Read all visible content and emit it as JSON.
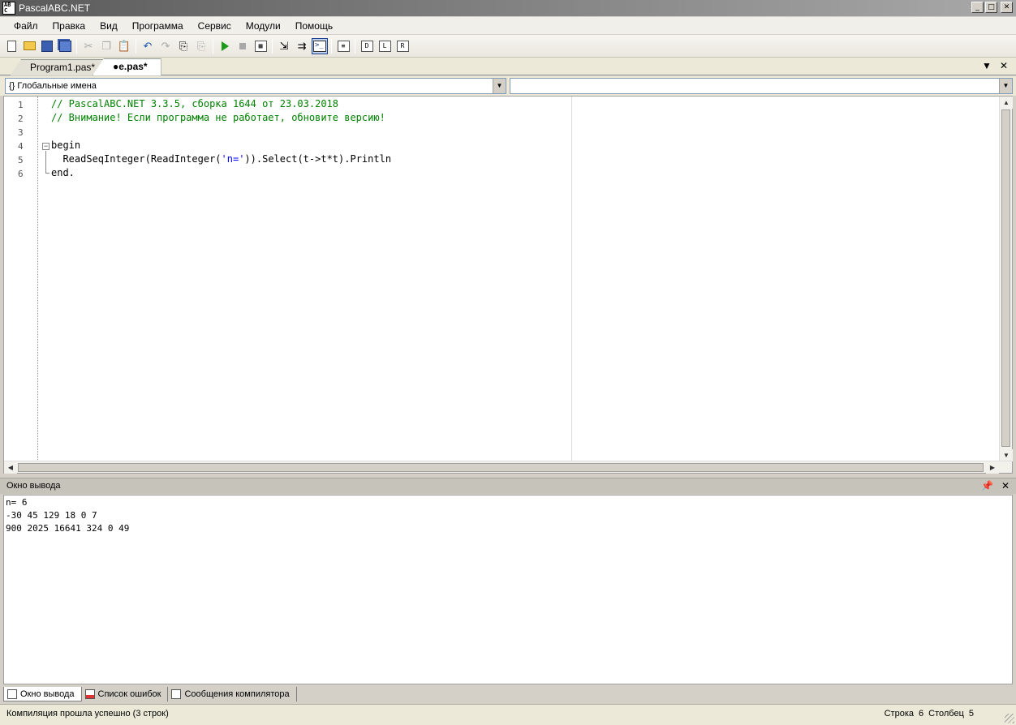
{
  "window": {
    "title": "PascalABC.NET",
    "icon_text": "AB\nC"
  },
  "menu": [
    "Файл",
    "Правка",
    "Вид",
    "Программа",
    "Сервис",
    "Модули",
    "Помощь"
  ],
  "tabs": [
    {
      "label": "Program1.pas*"
    },
    {
      "label": "●e.pas*"
    }
  ],
  "combos": {
    "left": "Глобальные имена",
    "left_prefix": "{}",
    "right": ""
  },
  "code": {
    "line_numbers": [
      "1",
      "2",
      "3",
      "4",
      "5",
      "6"
    ],
    "line1": "// PascalABC.NET 3.3.5, сборка 1644 от 23.03.2018",
    "line2": "// Внимание! Если программа не работает, обновите версию!",
    "line4": "begin",
    "line5_a": "  ReadSeqInteger(ReadInteger(",
    "line5_str": "'n='",
    "line5_b": ")).Select(t->t*t).Println",
    "line6": "end."
  },
  "output_panel": {
    "title": "Окно вывода",
    "lines": [
      "n= 6",
      "-30 45 129 18 0 7",
      "900 2025 16641 324 0 49"
    ]
  },
  "bottom_tabs": [
    "Окно вывода",
    "Список ошибок",
    "Сообщения компилятора"
  ],
  "status": {
    "message": "Компиляция прошла успешно (3 строк)",
    "row_label": "Строка",
    "row_value": "6",
    "col_label": "Столбец",
    "col_value": "5"
  },
  "colors": {
    "comment": "#008000",
    "string": "#0000ff",
    "accent": "#1c3d8a"
  },
  "toolbar_icons": [
    "new-file-icon",
    "open-folder-icon",
    "save-icon",
    "save-all-icon",
    "cut-icon",
    "copy-icon",
    "paste-icon",
    "undo-icon",
    "redo-icon",
    "find-icon",
    "replace-icon",
    "run-icon",
    "stop-icon",
    "debug-icon",
    "step-into-icon",
    "step-over-icon",
    "console-icon",
    "format-icon",
    "module-icon-1",
    "module-icon-2",
    "module-icon-3"
  ]
}
